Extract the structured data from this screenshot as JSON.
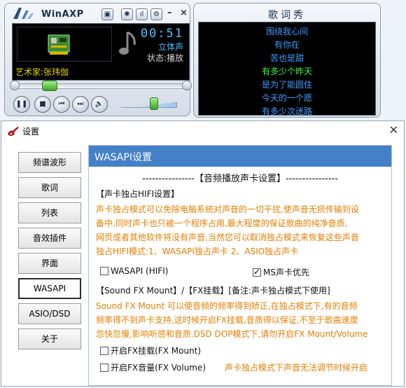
{
  "player": {
    "title": "WinAXP",
    "time": "00:51",
    "channel": "立体声",
    "status_label": "状态:",
    "status_value": "播放",
    "artist_label": "艺术家:",
    "artist_value": "张玮伽",
    "seek_position": 0.18,
    "volume_level": 0.62
  },
  "lyrics": {
    "title": "歌词秀",
    "lines": [
      "围绕我心间",
      "有你在",
      "苦也是甜",
      "有多少个昨天",
      "是为了能圆住",
      "今天的一个愿",
      "有多少次迷路"
    ],
    "current_index": 3
  },
  "settings": {
    "title": "设置",
    "nav": [
      "频谱波形",
      "歌词",
      "列表",
      "音效插件",
      "界面",
      "WASAPI",
      "ASIO/DSD",
      "关于"
    ],
    "active_index": 5,
    "panel_title": "WASAPI设置",
    "section_title": "----------------【音频播放声卡设置】----------------",
    "exclusive_head": "【声卡独占HIFI设置】",
    "exclusive_desc": [
      "声卡独占模式可以免除电脑系统对声音的一切干扰,使声音无损传输到设",
      "备中,同时声卡也只被一个程序占用,最大程度的保证歌曲的纯净音质,",
      "网页或者其他软件将没有声音,当然您可以取消独占模式来恢复这些声音",
      "独占HIFI模式:1、WASAPI独占声卡 2、ASIO独占声卡"
    ],
    "wasapi_hifi": {
      "label": "WASAPI (HIFI)",
      "checked": false
    },
    "ms_priority": {
      "label": "MS声卡优先",
      "checked": true
    },
    "fx_head": "【Sound FX Mount】/【FX挂载】[备注:声卡独占模式下使用]",
    "fx_desc": [
      "Sound FX Mount 可以使音频的频率得到矫正,在独占模式下,有的音频",
      "频率得不到声卡支持,这时候开启FX挂载,音质得以保证,不至于歌曲速度",
      "忽快忽慢,影响听感和音质.DSD DOP模式下,请勿开启FX Mount/Volume"
    ],
    "fx_mount": {
      "label": "开启FX挂载(FX Mount)",
      "checked": false
    },
    "fx_volume": {
      "label": "开启FX音量(FX Volume)",
      "checked": false
    },
    "fx_note": "声卡独占模式下声音无法调节时候开启"
  }
}
